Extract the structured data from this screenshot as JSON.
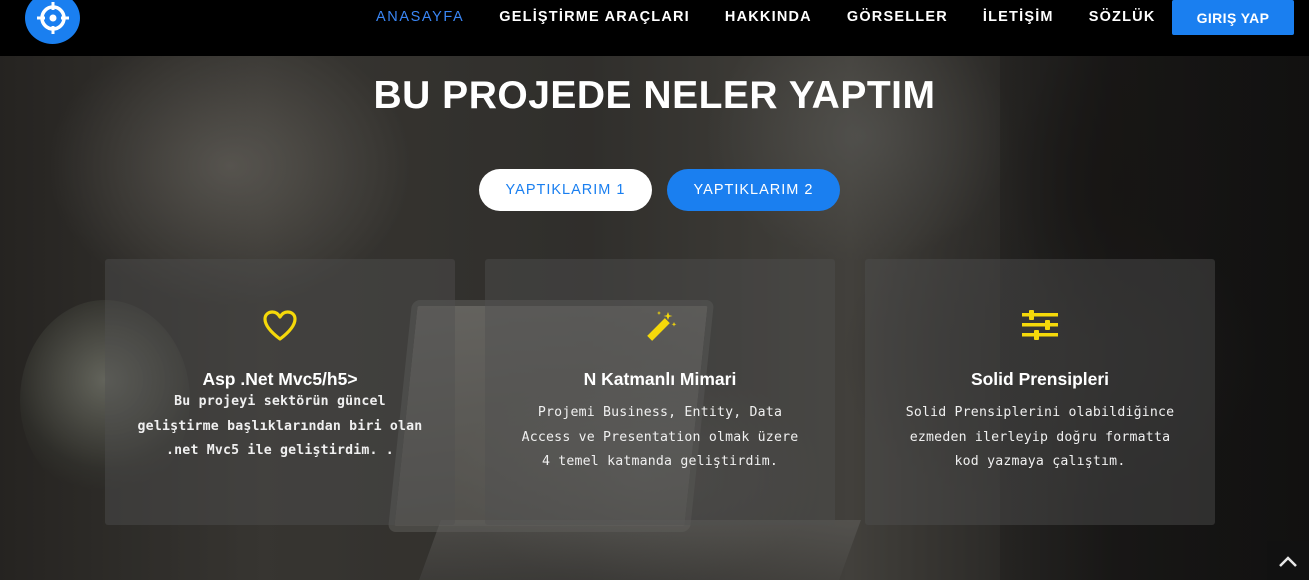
{
  "nav": {
    "items": [
      {
        "label": "ANASAYFA",
        "active": true
      },
      {
        "label": "GELİŞTİRME ARAÇLARI",
        "active": false
      },
      {
        "label": "HAKKINDA",
        "active": false
      },
      {
        "label": "GÖRSELLER",
        "active": false
      },
      {
        "label": "İLETİŞİM",
        "active": false
      },
      {
        "label": "SÖZLÜK",
        "active": false
      }
    ],
    "login_label": "GIRIŞ YAP"
  },
  "section": {
    "title": "BU PROJEDE NELER YAPTIM",
    "tabs": [
      {
        "label": "YAPTIKLARIM 1"
      },
      {
        "label": "YAPTIKLARIM 2"
      }
    ]
  },
  "cards": [
    {
      "icon": "heart-icon",
      "title": "Asp .Net Mvc5/h5>",
      "text": "Bu projeyi sektörün güncel geliştirme başlıklarından biri olan .net Mvc5 ile geliştirdim. ."
    },
    {
      "icon": "magic-wand-icon",
      "title": "N Katmanlı Mimari",
      "text": "Projemi Business, Entity, Data Access ve Presentation olmak üzere 4 temel katmanda geliştirdim."
    },
    {
      "icon": "sliders-icon",
      "title": "Solid Prensipleri",
      "text": "Solid Prensiplerini olabildiğince ezmeden ilerleyip doğru formatta kod yazmaya çalıştım."
    }
  ],
  "colors": {
    "accent": "#1a7ff0",
    "icon": "#f5d90a",
    "navbar": "#000000"
  }
}
